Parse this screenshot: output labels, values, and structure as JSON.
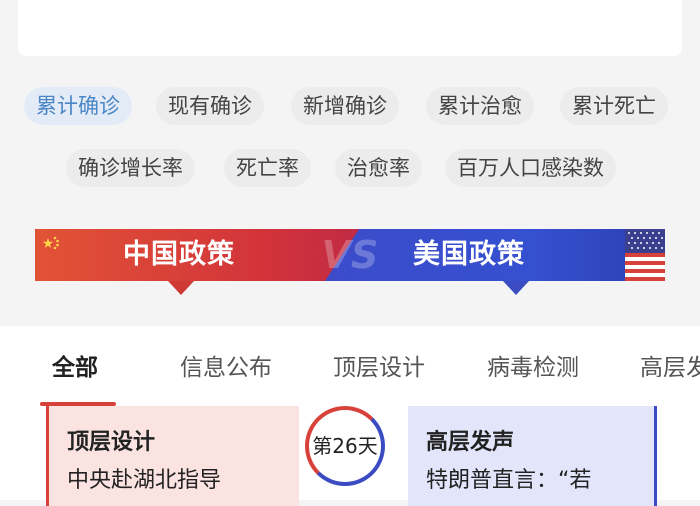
{
  "filter_chips": [
    {
      "label": "累计确诊",
      "active": true
    },
    {
      "label": "现有确诊",
      "active": false
    },
    {
      "label": "新增确诊",
      "active": false
    },
    {
      "label": "累计治愈",
      "active": false
    },
    {
      "label": "累计死亡",
      "active": false
    },
    {
      "label": "确诊增长率",
      "active": false
    },
    {
      "label": "死亡率",
      "active": false
    },
    {
      "label": "治愈率",
      "active": false
    },
    {
      "label": "百万人口感染数",
      "active": false
    }
  ],
  "banner": {
    "left_label": "中国政策",
    "right_label": "美国政策",
    "vs": "VS"
  },
  "tabs": [
    {
      "label": "全部",
      "active": true
    },
    {
      "label": "信息公布",
      "active": false
    },
    {
      "label": "顶层设计",
      "active": false
    },
    {
      "label": "病毒检测",
      "active": false
    },
    {
      "label": "高层发声",
      "active": false
    }
  ],
  "timeline": {
    "left_card": {
      "title": "顶层设计",
      "body": "中央赴湖北指导"
    },
    "day_badge": "第26天",
    "right_card": {
      "title": "高层发声",
      "body": "特朗普直言：“若"
    }
  },
  "colors": {
    "accent_blue": "#4b86c6",
    "china_red": "#d8403a",
    "us_blue": "#3b4cc3"
  }
}
